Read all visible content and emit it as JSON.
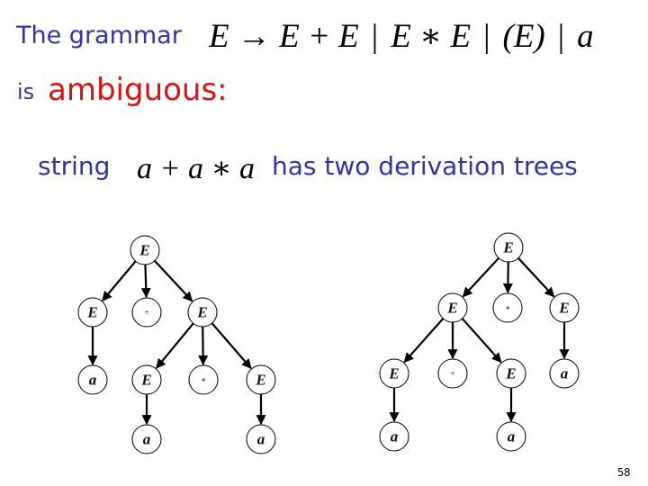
{
  "title_line": {
    "prefix": "The grammar",
    "production": "E → E + E",
    "alternatives": [
      "E ∗ E",
      "(E)",
      "a"
    ],
    "separator": "|"
  },
  "ambiguity_line": {
    "prefix": "is",
    "keyword": "ambiguous:",
    "keyword_color": "#dd1111"
  },
  "string_line": {
    "prefix": "string",
    "expression": "a + a ∗ a",
    "suffix": "has two derivation trees"
  },
  "text_color": "#3333aa",
  "page_number": "58",
  "trees": [
    {
      "name": "plus-at-root",
      "nodes": [
        {
          "id": "r",
          "label": "E",
          "parent": null
        },
        {
          "id": "c1",
          "label": "E",
          "parent": "r"
        },
        {
          "id": "c2",
          "label": "+",
          "parent": "r"
        },
        {
          "id": "c3",
          "label": "E",
          "parent": "r"
        },
        {
          "id": "c1a",
          "label": "a",
          "parent": "c1"
        },
        {
          "id": "c3a",
          "label": "E",
          "parent": "c3"
        },
        {
          "id": "c3b",
          "label": "∗",
          "parent": "c3"
        },
        {
          "id": "c3c",
          "label": "E",
          "parent": "c3"
        },
        {
          "id": "c3aa",
          "label": "a",
          "parent": "c3a"
        },
        {
          "id": "c3ca",
          "label": "a",
          "parent": "c3c"
        }
      ]
    },
    {
      "name": "times-at-root",
      "nodes": [
        {
          "id": "r",
          "label": "E",
          "parent": null
        },
        {
          "id": "c1",
          "label": "E",
          "parent": "r"
        },
        {
          "id": "c2",
          "label": "∗",
          "parent": "r"
        },
        {
          "id": "c3",
          "label": "E",
          "parent": "r"
        },
        {
          "id": "c1a",
          "label": "E",
          "parent": "c1"
        },
        {
          "id": "c1b",
          "label": "+",
          "parent": "c1"
        },
        {
          "id": "c1c",
          "label": "E",
          "parent": "c1"
        },
        {
          "id": "c3a",
          "label": "a",
          "parent": "c3"
        },
        {
          "id": "c1aa",
          "label": "a",
          "parent": "c1a"
        },
        {
          "id": "c1ca",
          "label": "a",
          "parent": "c1c"
        }
      ]
    }
  ]
}
